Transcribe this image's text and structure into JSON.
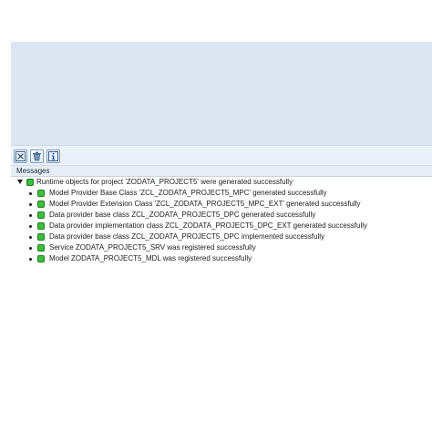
{
  "messages_panel": {
    "header": "Messages",
    "status_color": "#3cc03c",
    "root": {
      "text": "Runtime objects for project 'ZODATA_PROJECT5' were generated successfully",
      "status": "success"
    },
    "children": [
      {
        "text": "Model Provider Base Class 'ZCL_ZODATA_PROJECT5_MPC' generated successfully",
        "status": "success"
      },
      {
        "text": "Model Provider Extension Class 'ZCL_ZODATA_PROJECT5_MPC_EXT' generated successfully",
        "status": "success"
      },
      {
        "text": "Data provider base class ZCL_ZODATA_PROJECT5_DPC generated successfully",
        "status": "success"
      },
      {
        "text": "Data provider implementation class ZCL_ZODATA_PROJECT5_DPC_EXT generated successfully",
        "status": "success"
      },
      {
        "text": "Data provider base class ZCL_ZODATA_PROJECT5_DPC implemented successfully",
        "status": "success"
      },
      {
        "text": "Service ZODATA_PROJECT5_SRV was registered successfully",
        "status": "success"
      },
      {
        "text": "Model ZODATA_PROJECT5_MDL was registered successfully",
        "status": "success"
      }
    ]
  },
  "toolbar": {
    "buttons": [
      {
        "icon": "expand-all-icon"
      },
      {
        "icon": "delete-icon"
      },
      {
        "icon": "info-icon"
      }
    ]
  }
}
